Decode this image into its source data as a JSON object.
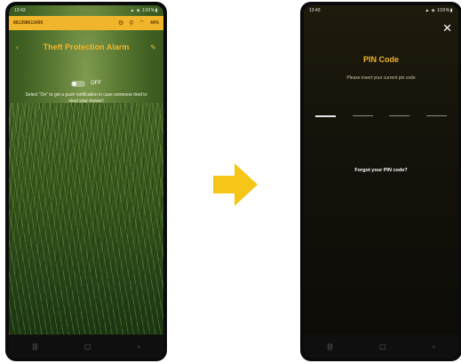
{
  "left_phone": {
    "status_bar": {
      "time": "13:43",
      "signal": "▲ ◈ 100%▮"
    },
    "header": {
      "device_id": "861398013495",
      "battery": "44%"
    },
    "title": "Theft Protection Alarm",
    "toggle_label": "OFF",
    "description": "Select \"On\" to get a push notification in case someone tried to steal your mower!"
  },
  "right_phone": {
    "status_bar": {
      "time": "13:43",
      "signal": "▲ ◈ 100%▮"
    },
    "pin_title": "PIN Code",
    "pin_subtitle": "Please insert your current pin code",
    "forgot_link": "Forgot your PIN code?"
  },
  "colors": {
    "accent": "#f1b52c",
    "arrow": "#f5c518"
  },
  "icons": {
    "back": "back-arrow-icon",
    "edit": "pencil-icon",
    "close": "close-icon",
    "settings": "gear-icon",
    "location": "location-pin-icon",
    "wifi": "wifi-icon"
  }
}
